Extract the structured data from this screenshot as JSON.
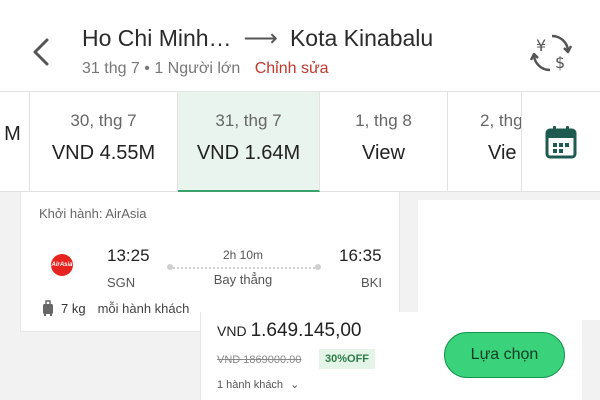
{
  "header": {
    "origin": "Ho Chi Minh…",
    "destination": "Kota Kinabalu",
    "date_pax": "31 thg 7 • 1 Người lớn",
    "edit_label": "Chỉnh sửa",
    "back_icon": "chevron-left-icon",
    "currency_icon": "currency-exchange-icon"
  },
  "dates": [
    {
      "date": "",
      "price": "M"
    },
    {
      "date": "30, thg 7",
      "price": "VND 4.55M"
    },
    {
      "date": "31, thg 7",
      "price": "VND 1.64M",
      "selected": true
    },
    {
      "date": "1, thg 8",
      "price": "View"
    },
    {
      "date": "2, thg",
      "price": "Vie"
    }
  ],
  "calendar_icon": "calendar-icon",
  "flight": {
    "departure_label": "Khởi hành: AirAsia",
    "airline_logo_text": "AirAsia",
    "dep_time": "13:25",
    "dep_code": "SGN",
    "arr_time": "16:35",
    "arr_code": "BKI",
    "duration": "2h 10m",
    "stops": "Bay thẳng",
    "baggage": "7 kg",
    "baggage_note": "mỗi hành khách"
  },
  "booking": {
    "currency": "VND",
    "price": "1.649.145,00",
    "old_price": "VND 1869000.00",
    "discount": "30%OFF",
    "passengers": "1 hành khách",
    "select_label": "Lựa chọn"
  },
  "colors": {
    "accent_green": "#3ad37b",
    "edit_red": "#c0392b",
    "selected_bg": "#e9f4ee",
    "icon_teal": "#1f5a50"
  }
}
